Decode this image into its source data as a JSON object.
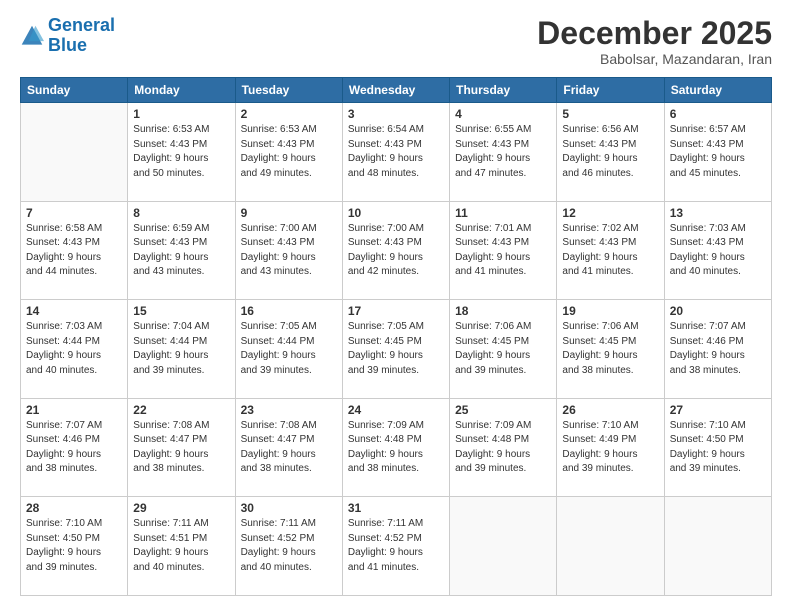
{
  "header": {
    "logo_line1": "General",
    "logo_line2": "Blue",
    "month": "December 2025",
    "location": "Babolsar, Mazandaran, Iran"
  },
  "weekdays": [
    "Sunday",
    "Monday",
    "Tuesday",
    "Wednesday",
    "Thursday",
    "Friday",
    "Saturday"
  ],
  "weeks": [
    [
      {
        "day": "",
        "info": ""
      },
      {
        "day": "1",
        "info": "Sunrise: 6:53 AM\nSunset: 4:43 PM\nDaylight: 9 hours\nand 50 minutes."
      },
      {
        "day": "2",
        "info": "Sunrise: 6:53 AM\nSunset: 4:43 PM\nDaylight: 9 hours\nand 49 minutes."
      },
      {
        "day": "3",
        "info": "Sunrise: 6:54 AM\nSunset: 4:43 PM\nDaylight: 9 hours\nand 48 minutes."
      },
      {
        "day": "4",
        "info": "Sunrise: 6:55 AM\nSunset: 4:43 PM\nDaylight: 9 hours\nand 47 minutes."
      },
      {
        "day": "5",
        "info": "Sunrise: 6:56 AM\nSunset: 4:43 PM\nDaylight: 9 hours\nand 46 minutes."
      },
      {
        "day": "6",
        "info": "Sunrise: 6:57 AM\nSunset: 4:43 PM\nDaylight: 9 hours\nand 45 minutes."
      }
    ],
    [
      {
        "day": "7",
        "info": "Sunrise: 6:58 AM\nSunset: 4:43 PM\nDaylight: 9 hours\nand 44 minutes."
      },
      {
        "day": "8",
        "info": "Sunrise: 6:59 AM\nSunset: 4:43 PM\nDaylight: 9 hours\nand 43 minutes."
      },
      {
        "day": "9",
        "info": "Sunrise: 7:00 AM\nSunset: 4:43 PM\nDaylight: 9 hours\nand 43 minutes."
      },
      {
        "day": "10",
        "info": "Sunrise: 7:00 AM\nSunset: 4:43 PM\nDaylight: 9 hours\nand 42 minutes."
      },
      {
        "day": "11",
        "info": "Sunrise: 7:01 AM\nSunset: 4:43 PM\nDaylight: 9 hours\nand 41 minutes."
      },
      {
        "day": "12",
        "info": "Sunrise: 7:02 AM\nSunset: 4:43 PM\nDaylight: 9 hours\nand 41 minutes."
      },
      {
        "day": "13",
        "info": "Sunrise: 7:03 AM\nSunset: 4:43 PM\nDaylight: 9 hours\nand 40 minutes."
      }
    ],
    [
      {
        "day": "14",
        "info": "Sunrise: 7:03 AM\nSunset: 4:44 PM\nDaylight: 9 hours\nand 40 minutes."
      },
      {
        "day": "15",
        "info": "Sunrise: 7:04 AM\nSunset: 4:44 PM\nDaylight: 9 hours\nand 39 minutes."
      },
      {
        "day": "16",
        "info": "Sunrise: 7:05 AM\nSunset: 4:44 PM\nDaylight: 9 hours\nand 39 minutes."
      },
      {
        "day": "17",
        "info": "Sunrise: 7:05 AM\nSunset: 4:45 PM\nDaylight: 9 hours\nand 39 minutes."
      },
      {
        "day": "18",
        "info": "Sunrise: 7:06 AM\nSunset: 4:45 PM\nDaylight: 9 hours\nand 39 minutes."
      },
      {
        "day": "19",
        "info": "Sunrise: 7:06 AM\nSunset: 4:45 PM\nDaylight: 9 hours\nand 38 minutes."
      },
      {
        "day": "20",
        "info": "Sunrise: 7:07 AM\nSunset: 4:46 PM\nDaylight: 9 hours\nand 38 minutes."
      }
    ],
    [
      {
        "day": "21",
        "info": "Sunrise: 7:07 AM\nSunset: 4:46 PM\nDaylight: 9 hours\nand 38 minutes."
      },
      {
        "day": "22",
        "info": "Sunrise: 7:08 AM\nSunset: 4:47 PM\nDaylight: 9 hours\nand 38 minutes."
      },
      {
        "day": "23",
        "info": "Sunrise: 7:08 AM\nSunset: 4:47 PM\nDaylight: 9 hours\nand 38 minutes."
      },
      {
        "day": "24",
        "info": "Sunrise: 7:09 AM\nSunset: 4:48 PM\nDaylight: 9 hours\nand 38 minutes."
      },
      {
        "day": "25",
        "info": "Sunrise: 7:09 AM\nSunset: 4:48 PM\nDaylight: 9 hours\nand 39 minutes."
      },
      {
        "day": "26",
        "info": "Sunrise: 7:10 AM\nSunset: 4:49 PM\nDaylight: 9 hours\nand 39 minutes."
      },
      {
        "day": "27",
        "info": "Sunrise: 7:10 AM\nSunset: 4:50 PM\nDaylight: 9 hours\nand 39 minutes."
      }
    ],
    [
      {
        "day": "28",
        "info": "Sunrise: 7:10 AM\nSunset: 4:50 PM\nDaylight: 9 hours\nand 39 minutes."
      },
      {
        "day": "29",
        "info": "Sunrise: 7:11 AM\nSunset: 4:51 PM\nDaylight: 9 hours\nand 40 minutes."
      },
      {
        "day": "30",
        "info": "Sunrise: 7:11 AM\nSunset: 4:52 PM\nDaylight: 9 hours\nand 40 minutes."
      },
      {
        "day": "31",
        "info": "Sunrise: 7:11 AM\nSunset: 4:52 PM\nDaylight: 9 hours\nand 41 minutes."
      },
      {
        "day": "",
        "info": ""
      },
      {
        "day": "",
        "info": ""
      },
      {
        "day": "",
        "info": ""
      }
    ]
  ]
}
